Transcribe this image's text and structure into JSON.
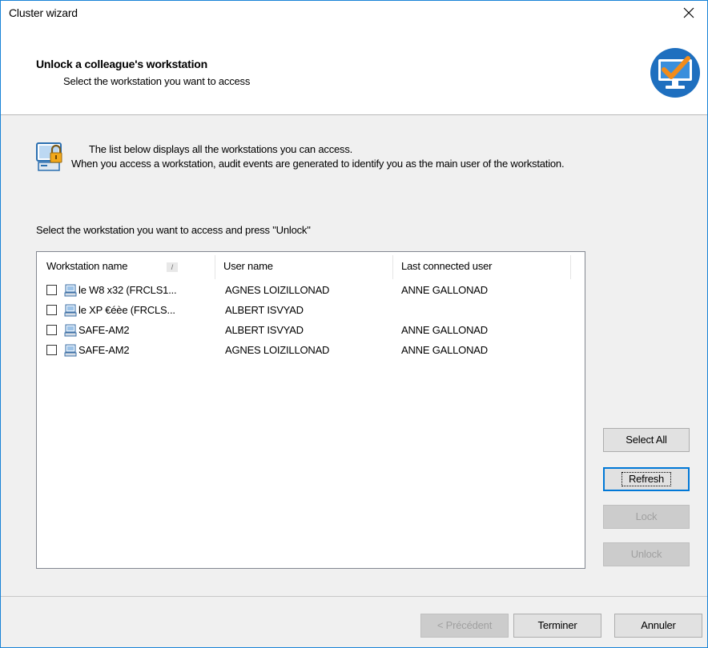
{
  "window": {
    "title": "Cluster wizard"
  },
  "header": {
    "title": "Unlock a colleague's workstation",
    "subtitle": "Select the workstation you want to access"
  },
  "info": {
    "line1": "The list below displays all the workstations you can access.",
    "line2": "When you access a workstation, audit events are generated to identify you as the main user of the workstation."
  },
  "instruction": "Select the workstation you want to access and press \"Unlock\"",
  "list": {
    "columns": [
      "Workstation name",
      "User name",
      "Last connected user"
    ],
    "sort_indicator": "/",
    "rows": [
      {
        "checked": false,
        "workstation": "le W8 x32 (FRCLS1...",
        "user": "AGNES LOIZILLONAD",
        "last_user": "ANNE GALLONAD"
      },
      {
        "checked": false,
        "workstation": "le XP €éèe (FRCLS...",
        "user": "ALBERT ISVYAD",
        "last_user": ""
      },
      {
        "checked": false,
        "workstation": "SAFE-AM2",
        "user": "ALBERT ISVYAD",
        "last_user": "ANNE GALLONAD"
      },
      {
        "checked": false,
        "workstation": "SAFE-AM2",
        "user": "AGNES LOIZILLONAD",
        "last_user": "ANNE GALLONAD"
      }
    ]
  },
  "side_buttons": {
    "select_all": "Select All",
    "refresh": "Refresh",
    "lock": "Lock",
    "unlock": "Unlock"
  },
  "footer_buttons": {
    "previous": "< Précédent",
    "finish": "Terminer",
    "cancel": "Annuler"
  },
  "icons": {
    "close": "close-icon",
    "logo": "monitor-check-logo-icon",
    "info": "workstation-lock-icon",
    "row": "workstation-icon"
  },
  "colors": {
    "accent": "#0078d7",
    "window_border": "#1883d7",
    "logo_blue": "#1e6fbf",
    "check_orange": "#f28c1a"
  }
}
